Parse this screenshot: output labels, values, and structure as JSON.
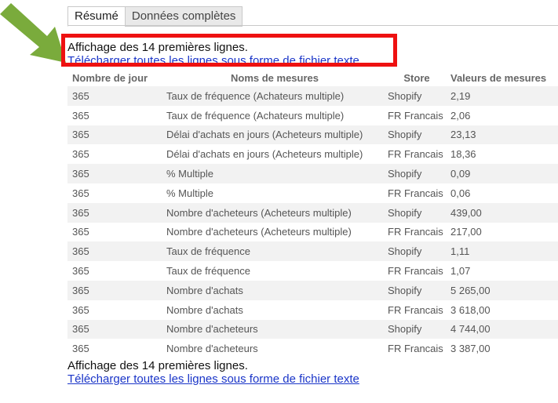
{
  "tabs": [
    {
      "label": "Résumé",
      "active": true
    },
    {
      "label": "Données complètes",
      "active": false
    }
  ],
  "info_text": "Affichage des 14 premières lignes.",
  "download_link": "Télécharger toutes les lignes sous forme de fichier texte",
  "colors": {
    "highlight": "#ee1111",
    "arrow": "#7aab3c",
    "link": "#1a35c8",
    "row_alt": "#f2f2f2"
  },
  "table": {
    "headers": [
      "Nombre de jour",
      "Noms de mesures",
      "Store",
      "Valeurs de mesures"
    ],
    "rows": [
      [
        "365",
        "Taux de fréquence (Achateurs multiple)",
        "Shopify",
        "2,19"
      ],
      [
        "365",
        "Taux de fréquence (Achateurs multiple)",
        "FR Francais",
        "2,06"
      ],
      [
        "365",
        "Délai d'achats en jours (Acheteurs multiple)",
        "Shopify",
        "23,13"
      ],
      [
        "365",
        "Délai d'achats en jours (Acheteurs multiple)",
        "FR Francais",
        "18,36"
      ],
      [
        "365",
        "% Multiple",
        "Shopify",
        "0,09"
      ],
      [
        "365",
        "% Multiple",
        "FR Francais",
        "0,06"
      ],
      [
        "365",
        "Nombre d'acheteurs (Acheteurs multiple)",
        "Shopify",
        "439,00"
      ],
      [
        "365",
        "Nombre d'acheteurs (Acheteurs multiple)",
        "FR Francais",
        "217,00"
      ],
      [
        "365",
        "Taux de fréquence",
        "Shopify",
        "1,11"
      ],
      [
        "365",
        "Taux de fréquence",
        "FR Francais",
        "1,07"
      ],
      [
        "365",
        "Nombre d'achats",
        "Shopify",
        "5 265,00"
      ],
      [
        "365",
        "Nombre d'achats",
        "FR Francais",
        "3 618,00"
      ],
      [
        "365",
        "Nombre d'acheteurs",
        "Shopify",
        "4 744,00"
      ],
      [
        "365",
        "Nombre d'acheteurs",
        "FR Francais",
        "3 387,00"
      ]
    ]
  }
}
